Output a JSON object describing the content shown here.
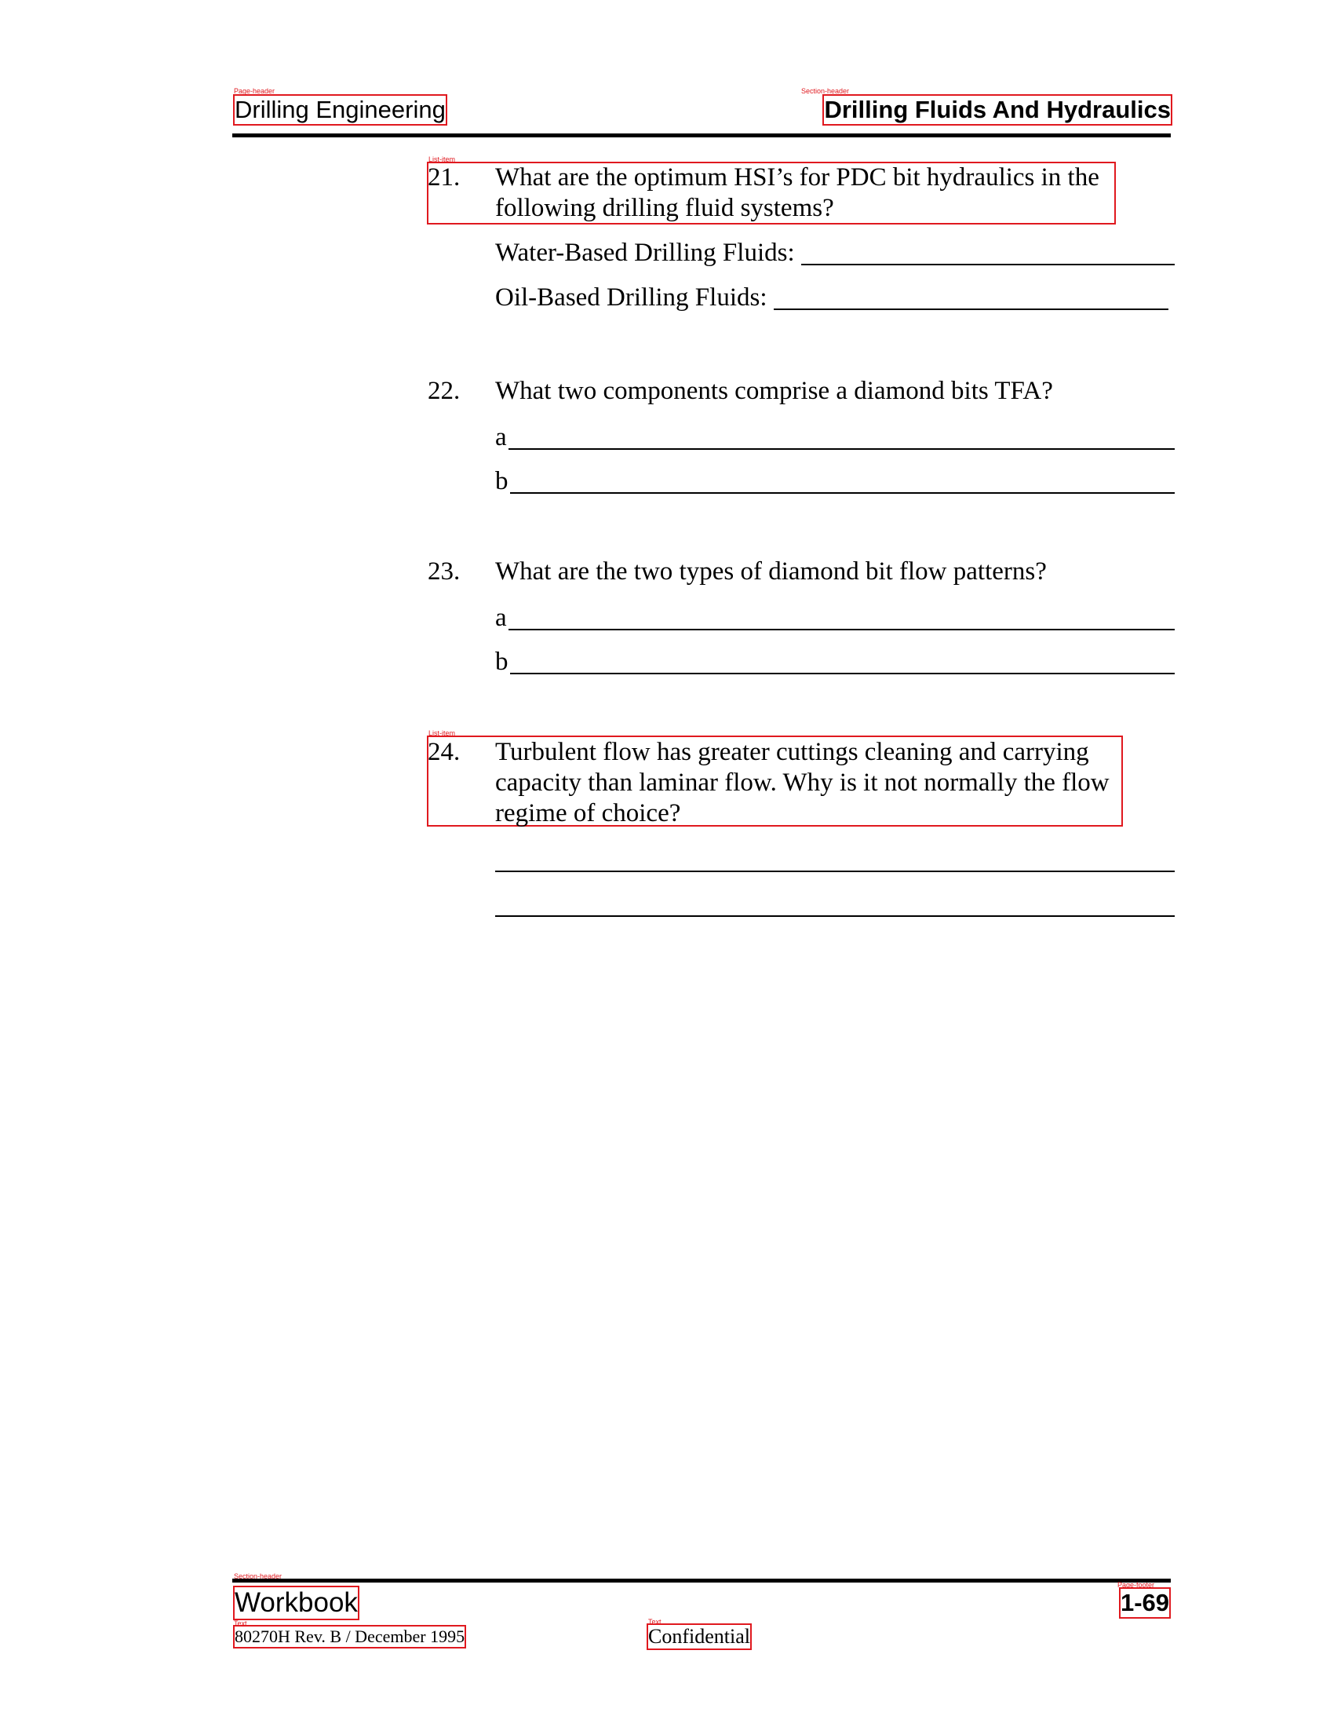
{
  "page_header": {
    "title": "Drilling Engineering",
    "tag": "Page-header"
  },
  "section_header": {
    "title": "Drilling Fluids And Hydraulics",
    "tag": "Section-header"
  },
  "questions": [
    {
      "number": "21.",
      "text": "What are the optimum HSI’s for PDC bit hydraulics in the following drilling fluid systems?",
      "tag": "List-item",
      "answers": [
        {
          "label": "Water-Based Drilling Fluids:"
        },
        {
          "label": "Oil-Based Drilling Fluids:"
        }
      ]
    },
    {
      "number": "22.",
      "text": "What two components comprise a diamond bits TFA?",
      "answers": [
        {
          "label": "a"
        },
        {
          "label": "b"
        }
      ]
    },
    {
      "number": "23.",
      "text": "What are the two types of diamond bit flow patterns?",
      "answers": [
        {
          "label": "a"
        },
        {
          "label": "b"
        }
      ]
    },
    {
      "number": "24.",
      "text": "Turbulent flow has greater cuttings cleaning and carrying capacity than laminar flow. Why is it not normally the flow regime of choice?",
      "tag": "List-item",
      "answers": [
        {
          "label": ""
        },
        {
          "label": ""
        }
      ]
    }
  ],
  "footer": {
    "workbook": "Workbook",
    "workbook_tag": "Section-header",
    "page_number": "1-69",
    "page_number_tag": "Page-footer",
    "revision": "80270H Rev. B / December 1995",
    "revision_tag": "Text",
    "confidential": "Confidential",
    "confidential_tag": "Text"
  },
  "colors": {
    "annotation_box": "#e0191f",
    "text": "#000000",
    "background": "#ffffff"
  }
}
